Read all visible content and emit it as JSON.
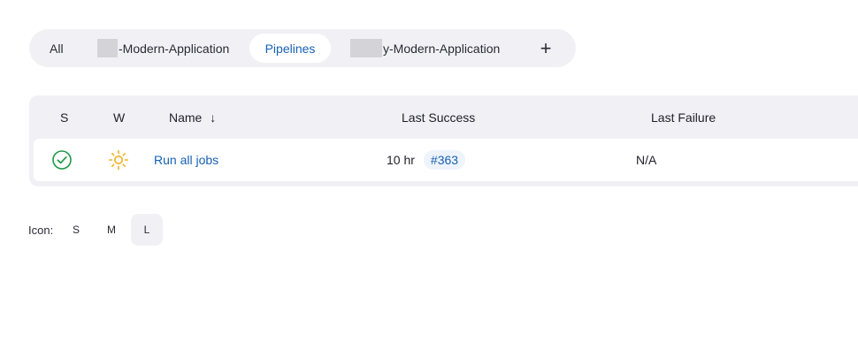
{
  "tabs": [
    {
      "label": "All",
      "active": false
    },
    {
      "label": "-Modern-Application",
      "active": false,
      "redacted_prefix": true
    },
    {
      "label": "Pipelines",
      "active": true
    },
    {
      "label": "y-Modern-Application",
      "active": false,
      "redacted_prefix": true
    }
  ],
  "add_tab_label": "+",
  "table": {
    "headers": {
      "status": "S",
      "weather": "W",
      "name": "Name",
      "sort_indicator": "↓",
      "last_success": "Last Success",
      "last_failure": "Last Failure"
    },
    "rows": [
      {
        "status_icon": "success-check-icon",
        "weather_icon": "sunny-weather-icon",
        "name": "Run all jobs",
        "last_success_time": "10 hr",
        "last_success_build": "#363",
        "last_failure": "N/A"
      }
    ]
  },
  "icon_size": {
    "label": "Icon:",
    "options": [
      "S",
      "M",
      "L"
    ],
    "selected": "L"
  },
  "colors": {
    "accent": "#1760b5",
    "success": "#1e9a46",
    "sunny": "#f2b01e",
    "panel_bg": "#f1f1f5"
  }
}
